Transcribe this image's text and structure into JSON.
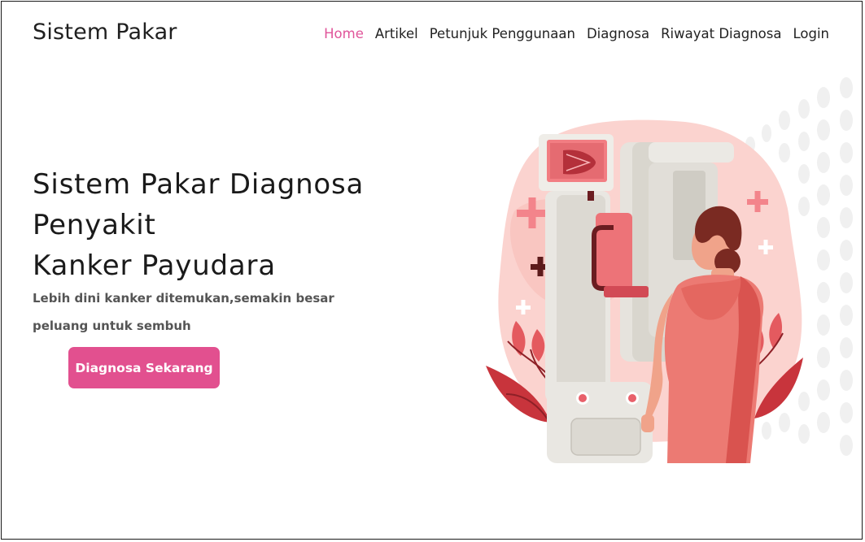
{
  "brand": {
    "name": "Sistem Pakar"
  },
  "nav": {
    "items": [
      {
        "label": "Home",
        "active": true
      },
      {
        "label": "Artikel",
        "active": false
      },
      {
        "label": "Petunjuk Penggunaan",
        "active": false
      },
      {
        "label": "Diagnosa",
        "active": false
      },
      {
        "label": "Riwayat Diagnosa",
        "active": false
      },
      {
        "label": "Login",
        "active": false
      }
    ]
  },
  "hero": {
    "title_lines": [
      "Sistem Pakar Diagnosa",
      "Penyakit",
      "Kanker Payudara"
    ],
    "subtitle_lines": [
      "Lebih dini kanker ditemukan,semakin besar",
      "peluang untuk sembuh"
    ],
    "cta_label": "Diagnosa Sekarang"
  },
  "illustration": {
    "icon": "mammography-illustration"
  },
  "colors": {
    "accent": "#e2508f",
    "nav_active": "#e0559a",
    "text_dark": "#1a1a1a",
    "text_muted": "#555555"
  }
}
